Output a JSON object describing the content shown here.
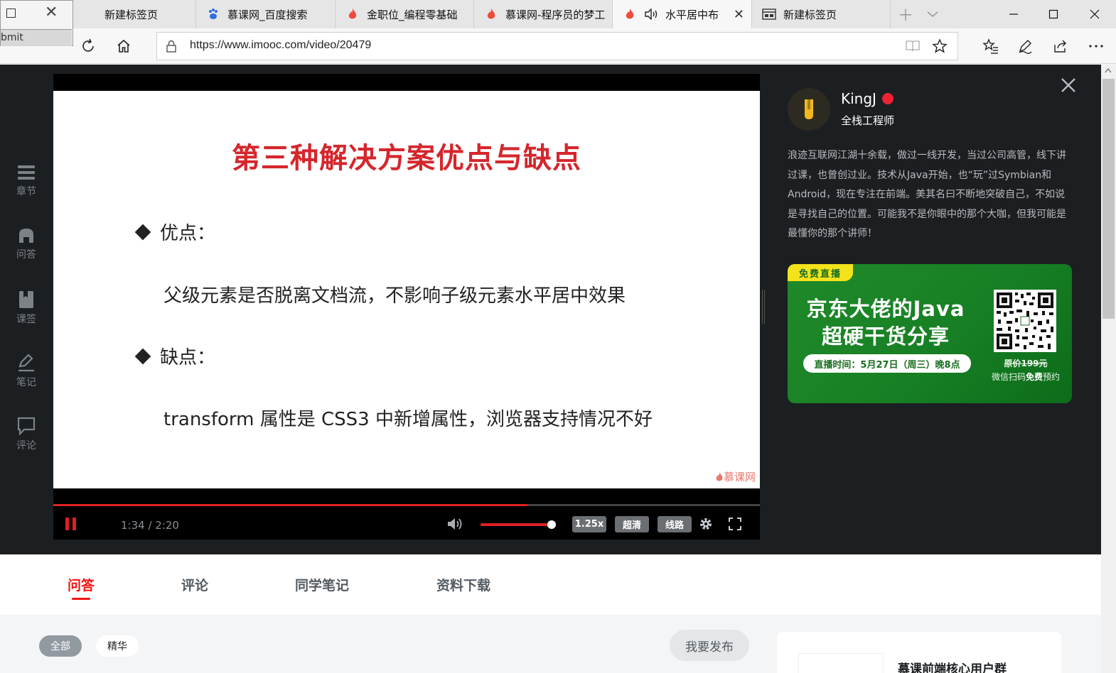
{
  "browser": {
    "tabs": [
      {
        "label": "新建标签页",
        "icon": "blank-page-icon",
        "active": false
      },
      {
        "label": "慕课网_百度搜索",
        "icon": "baidu-paw-icon",
        "active": false
      },
      {
        "label": "金职位_编程零基础",
        "icon": "imooc-flame-icon",
        "active": false
      },
      {
        "label": "慕课网-程序员的梦工",
        "icon": "imooc-flame-icon",
        "active": false
      },
      {
        "label": "水平居中布",
        "icon": "imooc-flame-icon",
        "active": true
      },
      {
        "label": "新建标签页",
        "icon": "new-tab-page-icon",
        "active": false
      }
    ],
    "popup_field_text": "bmit",
    "url": "https://www.imooc.com/video/20479"
  },
  "left_nav": [
    {
      "label": "章节",
      "icon": "chapters-icon"
    },
    {
      "label": "问答",
      "icon": "qa-icon"
    },
    {
      "label": "课签",
      "icon": "bookmark-icon"
    },
    {
      "label": "笔记",
      "icon": "note-icon"
    },
    {
      "label": "评论",
      "icon": "comment-icon"
    }
  ],
  "slide": {
    "title": "第三种解决方案优点与缺点",
    "pros_label": "优点：",
    "pros_text": "父级元素是否脱离文档流，不影响子级元素水平居中效果",
    "cons_label": "缺点：",
    "cons_text": "transform 属性是 CSS3 中新增属性，浏览器支持情况不好",
    "watermark": "慕课网"
  },
  "player": {
    "current_time": "1:34",
    "duration": "2:20",
    "progress": 0.6714,
    "volume": 1.0,
    "speed_label": "1.25x",
    "quality_label": "超清",
    "route_label": "线路",
    "accent_color": "#e02020"
  },
  "teacher": {
    "name": "KingJ",
    "title": "全栈工程师",
    "bio": "浪迹互联网江湖十余载，做过一线开发，当过公司高管，线下讲过课，也曾创过业。技术从Java开始，也“玩”过Symbian和Android，现在专注在前端。美其名曰不断地突破自己，不如说是寻找自己的位置。可能我不是你眼中的那个大咖，但我可能是最懂你的那个讲师！"
  },
  "banner": {
    "tag": "免费直播",
    "headline_1": "京东大佬的Java",
    "headline_2": "超硬干货分享",
    "schedule": "直播时间：5月27日（周三）晚8点",
    "original_price": "原价199元",
    "cta_prefix": "微信扫码",
    "cta_bold": "免费",
    "cta_suffix": "预约",
    "bg_color": "#178024",
    "tag_color": "#f4e21b"
  },
  "content_tabs": [
    {
      "label": "问答",
      "active": true
    },
    {
      "label": "评论",
      "active": false
    },
    {
      "label": "同学笔记",
      "active": false
    },
    {
      "label": "资料下载",
      "active": false
    }
  ],
  "filters": {
    "all_label": "全部",
    "featured_label": "精华"
  },
  "publish_button": "我要发布",
  "side_card_title": "慕课前端核心用户群"
}
